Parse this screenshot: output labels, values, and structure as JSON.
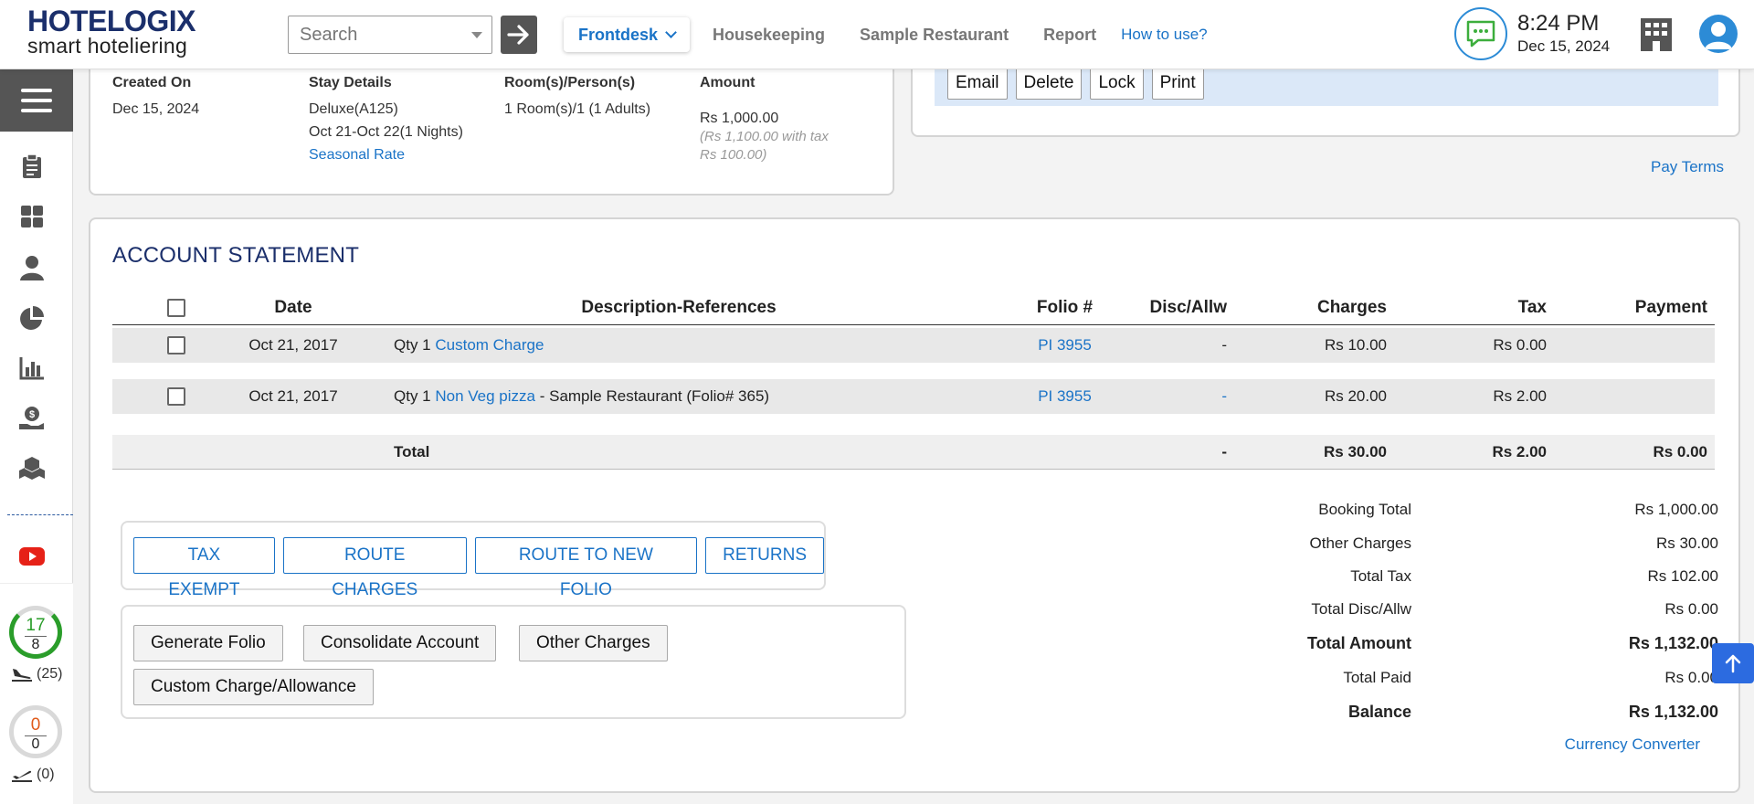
{
  "app": {
    "logo_main": "HOTELOGIX",
    "logo_sub": "smart hoteliering",
    "search_placeholder": "Search",
    "nav": {
      "frontdesk": "Frontdesk",
      "housekeeping": "Housekeeping",
      "restaurant": "Sample Restaurant",
      "report": "Report",
      "how_to": "How to use?"
    },
    "time": "8:24 PM",
    "date": "Dec 15, 2024"
  },
  "sidebar": {
    "icons": [
      "clipboard-icon",
      "dashboard-icon",
      "person-icon",
      "pie-chart-icon",
      "bar-chart-icon",
      "money-hand-icon",
      "boxes-icon",
      "youtube-icon"
    ],
    "arrivals": {
      "top": "17",
      "bottom": "8",
      "count": "(25)",
      "top_color": "#2a9d2a"
    },
    "departures": {
      "top": "0",
      "bottom": "0",
      "count": "(0)",
      "top_color": "#e05a1a"
    }
  },
  "booking": {
    "created_on_label": "Created On",
    "created_on": "Dec 15, 2024",
    "stay_label": "Stay Details",
    "stay_room": "Deluxe(A125)",
    "stay_dates": "Oct 21-Oct 22(1 Nights)",
    "stay_rate": "Seasonal Rate",
    "rooms_label": "Room(s)/Person(s)",
    "rooms_value": "1 Room(s)/1 (1 Adults)",
    "amount_label": "Amount",
    "amount": "Rs 1,000.00",
    "amount_tax_note": "(Rs 1,100.00 with tax",
    "amount_tax_value": "Rs 100.00)"
  },
  "actions": {
    "email": "Email",
    "delete": "Delete",
    "lock": "Lock",
    "print": "Print",
    "pay_terms": "Pay Terms"
  },
  "account": {
    "title": "ACCOUNT STATEMENT",
    "columns": {
      "date": "Date",
      "description": "Description-References",
      "folio": "Folio #",
      "disc": "Disc/Allw",
      "charges": "Charges",
      "tax": "Tax",
      "payment": "Payment"
    },
    "rows": [
      {
        "date": "Oct 21, 2017",
        "qty": "Qty 1",
        "item": "Custom Charge",
        "ref": "",
        "folio": "PI 3955",
        "disc": "-",
        "charges": "Rs 10.00",
        "tax": "Rs 0.00",
        "payment": ""
      },
      {
        "date": "Oct 21, 2017",
        "qty": "Qty 1",
        "item": "Non Veg pizza",
        "ref": " - Sample Restaurant (Folio# 365)",
        "folio": "PI 3955",
        "disc": "-",
        "charges": "Rs 20.00",
        "tax": "Rs 2.00",
        "payment": ""
      }
    ],
    "total": {
      "label": "Total",
      "disc": "-",
      "charges": "Rs 30.00",
      "tax": "Rs 2.00",
      "payment": "Rs 0.00"
    },
    "buttons_primary": {
      "tax_exempt": "TAX EXEMPT",
      "route_charges": "ROUTE CHARGES",
      "route_new_folio": "ROUTE TO NEW FOLIO",
      "returns": "RETURNS"
    },
    "buttons_secondary": {
      "generate_folio": "Generate Folio",
      "consolidate": "Consolidate Account",
      "other_charges": "Other Charges",
      "custom_charge": "Custom Charge/Allowance"
    },
    "summary": {
      "booking_total_label": "Booking Total",
      "booking_total": "Rs 1,000.00",
      "other_charges_label": "Other Charges",
      "other_charges": "Rs 30.00",
      "total_tax_label": "Total Tax",
      "total_tax": "Rs 102.00",
      "total_disc_label": "Total Disc/Allw",
      "total_disc": "Rs 0.00",
      "total_amount_label": "Total Amount",
      "total_amount": "Rs 1,132.00",
      "total_paid_label": "Total Paid",
      "total_paid": "Rs 0.00",
      "balance_label": "Balance",
      "balance": "Rs 1,132.00"
    },
    "currency_converter": "Currency Converter"
  },
  "colors": {
    "brand": "#1b2f6b",
    "link": "#1a73c7",
    "accent": "#2c6be0"
  }
}
